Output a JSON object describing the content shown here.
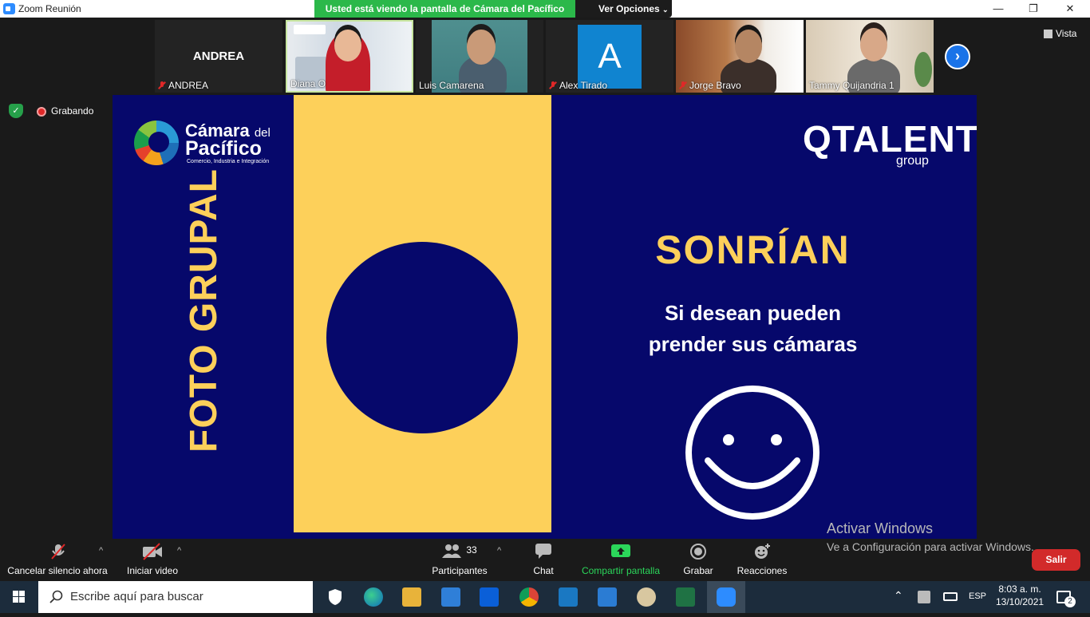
{
  "window": {
    "title": "Zoom Reunión",
    "share_banner": "Usted está viendo la pantalla de Cámara del Pacífico",
    "view_options": "Ver Opciones",
    "minimize": "—",
    "maximize": "❐",
    "close": "✕"
  },
  "gallery": {
    "view_label": "Vista",
    "next_icon": "chevron-right-icon",
    "participants": [
      {
        "name": "ANDREA",
        "big_label": "ANDREA",
        "muted": true
      },
      {
        "name": "Diana O",
        "muted": false
      },
      {
        "name": "Luis Camarena",
        "muted": false
      },
      {
        "name": "Alex Tirado",
        "avatar_letter": "A",
        "muted": true
      },
      {
        "name": "Jorge Bravo",
        "muted": true
      },
      {
        "name": "Tammy Quijandria 1",
        "muted": false
      }
    ]
  },
  "recording": {
    "label": "Grabando"
  },
  "slide": {
    "logo_left": {
      "line1": "Cámara",
      "line1b": "del",
      "line2": "Pacífico",
      "line3": "Comercio, Industria e Integración"
    },
    "logo_right": {
      "main": "QTALENT",
      "sub": "group"
    },
    "vertical_title": "FOTO GRUPAL",
    "headline": "SONRÍAN",
    "subline1": "Si desean pueden",
    "subline2": "prender sus cámaras",
    "colors": {
      "navy": "#06086b",
      "yellow": "#fdd05a"
    }
  },
  "watermark": {
    "line1": "Activar Windows",
    "line2": "Ve a Configuración para activar Windows."
  },
  "toolbar": {
    "unmute": "Cancelar silencio ahora",
    "start_video": "Iniciar video",
    "participants": "Participantes",
    "participants_count": "33",
    "chat": "Chat",
    "share": "Compartir pantalla",
    "record": "Grabar",
    "reactions": "Reacciones",
    "leave": "Salir"
  },
  "taskbar": {
    "search_placeholder": "Escribe aquí para buscar",
    "language": "ESP",
    "time": "8:03 a. m.",
    "date": "13/10/2021",
    "notifications": "2"
  }
}
